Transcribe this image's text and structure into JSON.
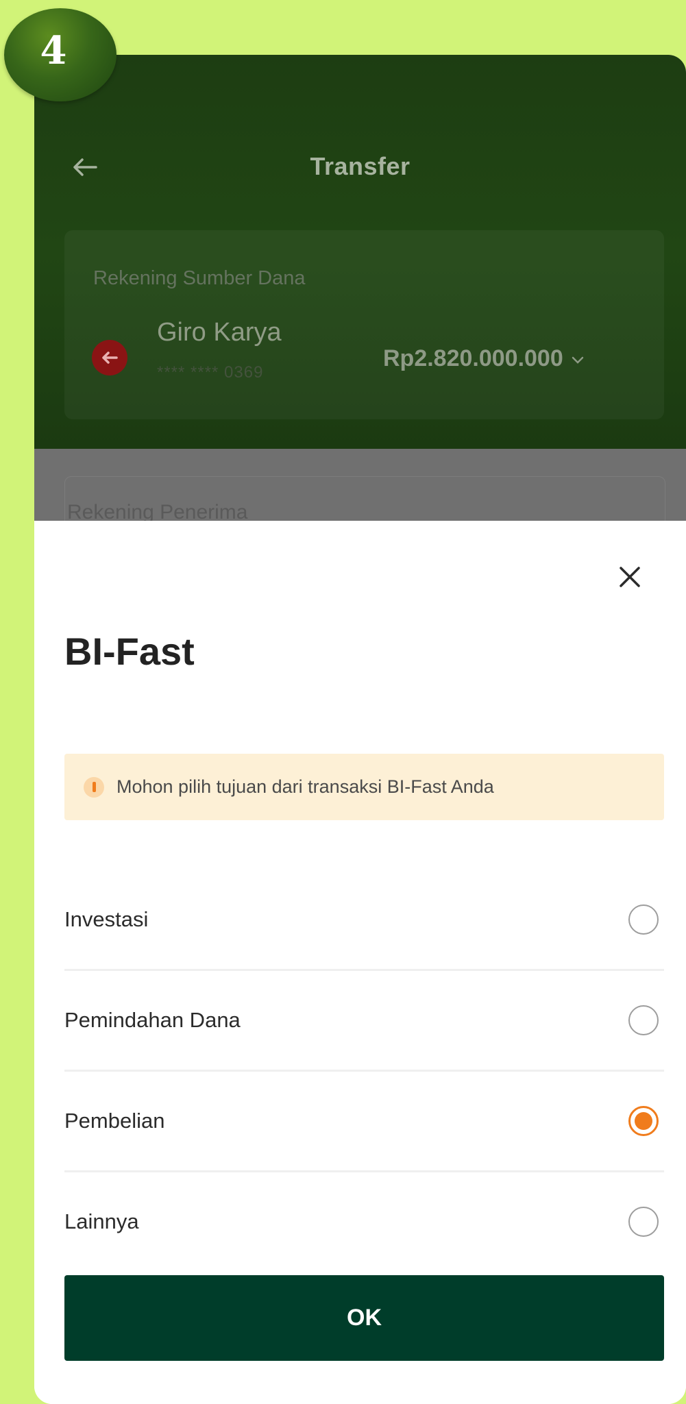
{
  "step_badge": {
    "number": "4"
  },
  "header": {
    "title": "Transfer"
  },
  "source_account": {
    "label": "Rekening Sumber Dana",
    "name": "Giro Karya",
    "number": "**** **** 0369",
    "balance": "Rp2.820.000.000"
  },
  "recipient": {
    "label": "Rekening Penerima"
  },
  "sheet": {
    "title": "BI-Fast",
    "info": "Mohon pilih tujuan dari transaksi BI-Fast Anda",
    "options": [
      {
        "label": "Investasi",
        "selected": false
      },
      {
        "label": "Pemindahan Dana",
        "selected": false
      },
      {
        "label": "Pembelian",
        "selected": true
      },
      {
        "label": "Lainnya",
        "selected": false
      }
    ],
    "ok_label": "OK"
  },
  "colors": {
    "page_background": "#d1f378",
    "header_background": "#214614",
    "accent_orange": "#f07c1c",
    "button_green": "#003d2a",
    "info_banner": "#fdf0d6"
  }
}
